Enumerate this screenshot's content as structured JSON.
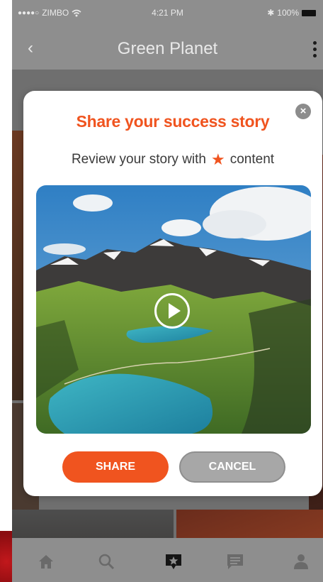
{
  "status_bar": {
    "signal_dots": "●●●●○",
    "carrier": "ZIMBO",
    "time": "4:21 PM",
    "bluetooth": "✱",
    "battery": "100%"
  },
  "nav": {
    "back_icon": "‹",
    "title": "Green Planet"
  },
  "modal": {
    "title": "Share your success story",
    "subtitle_before": "Review your story with",
    "subtitle_after": "content",
    "close_icon": "×",
    "share_label": "SHARE",
    "cancel_label": "CANCEL"
  },
  "tabbar": {
    "items": [
      "home-icon",
      "search-icon",
      "add-story-icon",
      "messages-icon",
      "profile-icon"
    ],
    "active_index": 2
  },
  "colors": {
    "accent": "#f0541f",
    "cancel": "#a7a7a7",
    "overlay_bar": "#8e8e8e"
  }
}
